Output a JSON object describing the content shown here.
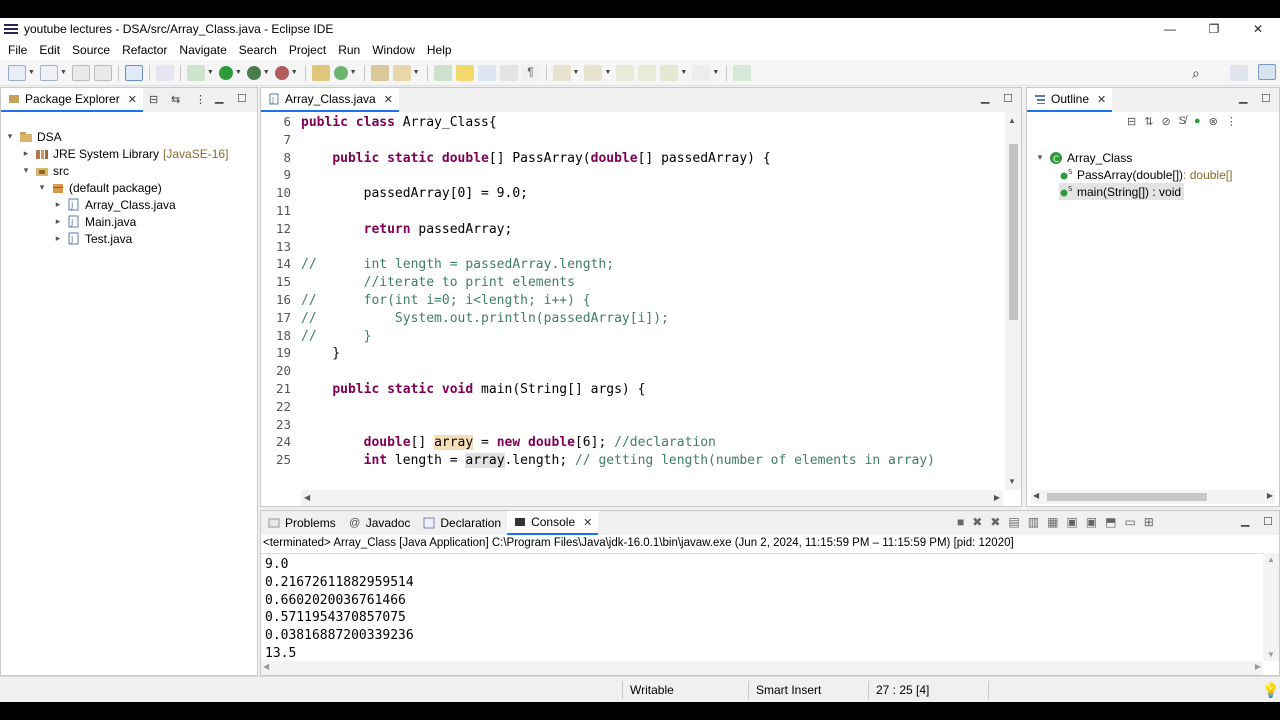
{
  "window": {
    "title": "youtube lectures - DSA/src/Array_Class.java - Eclipse IDE"
  },
  "menu": [
    "File",
    "Edit",
    "Source",
    "Refactor",
    "Navigate",
    "Search",
    "Project",
    "Run",
    "Window",
    "Help"
  ],
  "package_explorer": {
    "title": "Package Explorer",
    "tree": [
      {
        "label": "DSA",
        "depth": 0,
        "twisty": "▾",
        "icon": "project-icon"
      },
      {
        "label": "JRE System Library",
        "suffix": "[JavaSE-16]",
        "depth": 1,
        "twisty": "▸",
        "icon": "library-icon"
      },
      {
        "label": "src",
        "depth": 1,
        "twisty": "▾",
        "icon": "source-folder-icon"
      },
      {
        "label": "(default package)",
        "depth": 2,
        "twisty": "▾",
        "icon": "package-icon"
      },
      {
        "label": "Array_Class.java",
        "depth": 3,
        "twisty": "▸",
        "icon": "java-file-icon"
      },
      {
        "label": "Main.java",
        "depth": 3,
        "twisty": "▸",
        "icon": "java-file-icon"
      },
      {
        "label": "Test.java",
        "depth": 3,
        "twisty": "▸",
        "icon": "java-file-icon"
      }
    ]
  },
  "editor": {
    "tab": "Array_Class.java",
    "lines": [
      {
        "n": "6",
        "tokens": [
          {
            "t": "public",
            "c": "kw"
          },
          {
            "t": " "
          },
          {
            "t": "class",
            "c": "kw"
          },
          {
            "t": " Array_Class{"
          }
        ]
      },
      {
        "n": "7",
        "tokens": []
      },
      {
        "n": "8",
        "tokens": [
          {
            "t": "    "
          },
          {
            "t": "public",
            "c": "kw"
          },
          {
            "t": " "
          },
          {
            "t": "static",
            "c": "kw"
          },
          {
            "t": " "
          },
          {
            "t": "double",
            "c": "kw"
          },
          {
            "t": "[] PassArray("
          },
          {
            "t": "double",
            "c": "kw"
          },
          {
            "t": "[] passedArray) {"
          }
        ]
      },
      {
        "n": "9",
        "tokens": []
      },
      {
        "n": "10",
        "tokens": [
          {
            "t": "        passedArray[0] = 9.0;"
          }
        ]
      },
      {
        "n": "11",
        "tokens": []
      },
      {
        "n": "12",
        "tokens": [
          {
            "t": "        "
          },
          {
            "t": "return",
            "c": "kw"
          },
          {
            "t": " passedArray;"
          }
        ]
      },
      {
        "n": "13",
        "tokens": []
      },
      {
        "n": "14",
        "tokens": [
          {
            "t": "//      int length = passedArray.length;",
            "c": "cm"
          }
        ]
      },
      {
        "n": "15",
        "tokens": [
          {
            "t": "        //iterate to print elements",
            "c": "cm"
          }
        ]
      },
      {
        "n": "16",
        "tokens": [
          {
            "t": "//      for(int i=0; i<length; i++) {",
            "c": "cm"
          }
        ]
      },
      {
        "n": "17",
        "tokens": [
          {
            "t": "//          System.out.println(passedArray[i]);",
            "c": "cm"
          }
        ]
      },
      {
        "n": "18",
        "tokens": [
          {
            "t": "//      }",
            "c": "cm"
          }
        ]
      },
      {
        "n": "19",
        "tokens": [
          {
            "t": "    }"
          }
        ]
      },
      {
        "n": "20",
        "tokens": []
      },
      {
        "n": "21",
        "tokens": [
          {
            "t": "    "
          },
          {
            "t": "public",
            "c": "kw"
          },
          {
            "t": " "
          },
          {
            "t": "static",
            "c": "kw"
          },
          {
            "t": " "
          },
          {
            "t": "void",
            "c": "kw"
          },
          {
            "t": " main(String[] args) {"
          }
        ]
      },
      {
        "n": "22",
        "tokens": []
      },
      {
        "n": "23",
        "tokens": []
      },
      {
        "n": "24",
        "tokens": [
          {
            "t": "        "
          },
          {
            "t": "double",
            "c": "kw"
          },
          {
            "t": "[] "
          },
          {
            "t": "array",
            "c": "hl"
          },
          {
            "t": " = "
          },
          {
            "t": "new",
            "c": "kw"
          },
          {
            "t": " "
          },
          {
            "t": "double",
            "c": "kw"
          },
          {
            "t": "[6]; "
          },
          {
            "t": "//declaration",
            "c": "cm"
          }
        ]
      },
      {
        "n": "25",
        "tokens": [
          {
            "t": "        "
          },
          {
            "t": "int",
            "c": "kw"
          },
          {
            "t": " length = "
          },
          {
            "t": "array",
            "c": "hl2"
          },
          {
            "t": ".length; "
          },
          {
            "t": "// getting length(number of elements in array)",
            "c": "cm"
          }
        ]
      }
    ]
  },
  "outline": {
    "title": "Outline",
    "items": [
      {
        "label": "Array_Class",
        "depth": 0,
        "twisty": "▾",
        "icon": "class-icon"
      },
      {
        "label": "PassArray(double[])",
        "suffix": " : double[]",
        "depth": 1,
        "icon": "static-method-icon"
      },
      {
        "label": "main(String[]) : void",
        "depth": 1,
        "icon": "static-method-icon",
        "selected": true
      }
    ]
  },
  "bottom": {
    "tabs": [
      "Problems",
      "Javadoc",
      "Declaration",
      "Console"
    ],
    "active_tab": "Console",
    "terminated": "<terminated> Array_Class [Java Application] C:\\Program Files\\Java\\jdk-16.0.1\\bin\\javaw.exe  (Jun 2, 2024, 11:15:59 PM – 11:15:59 PM) [pid: 12020]",
    "output": [
      "9.0",
      "0.21672611882959514",
      "0.6602020036761466",
      "0.5711954370857075",
      "0.03816887200339236",
      "13.5"
    ]
  },
  "status": {
    "writable": "Writable",
    "insert_mode": "Smart Insert",
    "position": "27 : 25 [4]"
  }
}
